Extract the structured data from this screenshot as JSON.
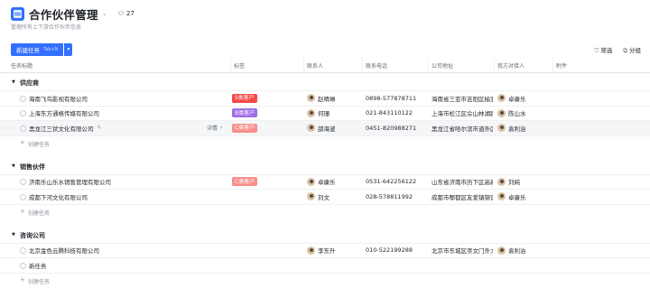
{
  "header": {
    "title": "合作伙伴管理",
    "member_count": "27",
    "subtitle": "管理所有上下游合作伙伴信息"
  },
  "toolbar": {
    "new_task": "新建任务",
    "shortcut": "Tab+N",
    "filter": "筛选",
    "group": "分组"
  },
  "columns": {
    "task_title": "任务标题",
    "tag": "标签",
    "contact": "联系人",
    "phone": "联系电话",
    "address": "公司地址",
    "our_contact": "我方对接人",
    "attachment": "附件"
  },
  "labels": {
    "create_task": "创建任务",
    "detail": "详情",
    "new_task_row": "新任务"
  },
  "colors": {
    "accent": "#3370ff",
    "tag_s": "#f54a45",
    "tag_b": "#9f6fe5",
    "tag_c": "#f98e8b"
  },
  "groups": [
    {
      "name": "供应商",
      "rows": [
        {
          "title": "海南飞鸟影视有限公司",
          "tag": "S类客户",
          "contact": "赵晴琳",
          "phone": "0898-577878711",
          "address": "海南省三亚市吉阳区榆亚大",
          "our": "卓康乐"
        },
        {
          "title": "上海东方通格传媒有限公司",
          "tag": "B类客户",
          "contact": "何珊",
          "phone": "021-843110122",
          "address": "上海市松江区佘山林湖路8",
          "our": "陈山水"
        },
        {
          "title": "黑龙江三状文化有限公司",
          "tag": "C类客户",
          "contact": "邵海波",
          "phone": "0451-820988271",
          "address": "黑龙江省哈尔滨市道外区松",
          "our": "袁利治"
        }
      ]
    },
    {
      "name": "销售伙伴",
      "rows": [
        {
          "title": "济南乐山乐水销售管理有限公司",
          "tag": "C类客户",
          "contact": "卓康乐",
          "phone": "0531-642256122",
          "address": "山东省济南市历下区高新区",
          "our": "刘純"
        },
        {
          "title": "成都下河文化有限公司",
          "tag": "",
          "contact": "刘文",
          "phone": "028-578811992",
          "address": "成都市郫都区友爱镇锦官者",
          "our": "卓康乐"
        }
      ]
    },
    {
      "name": "咨询公司",
      "rows": [
        {
          "title": "北京金色云腾科技有限公司",
          "tag": "",
          "contact": "李东升",
          "phone": "010-522199288",
          "address": "北京市东城区崇文门外大街",
          "our": "袁利治"
        }
      ],
      "extra_row": "新任务"
    }
  ]
}
